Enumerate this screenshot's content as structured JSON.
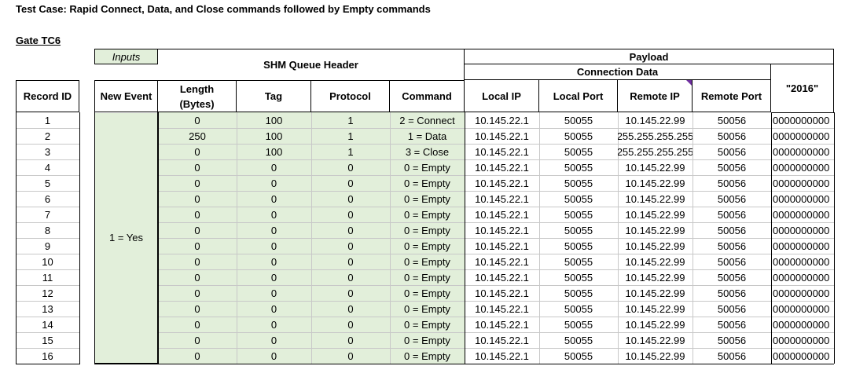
{
  "title": "Test Case: Rapid Connect, Data, and Close commands followed by Empty commands",
  "gate": "Gate TC6",
  "headers": {
    "inputs": "Inputs",
    "shm_queue_header": "SHM Queue Header",
    "payload": "Payload",
    "connection_data": "Connection Data",
    "record_id": "Record ID",
    "new_event": "New Event",
    "length": "Length",
    "length_unit": "(Bytes)",
    "tag": "Tag",
    "protocol": "Protocol",
    "command": "Command",
    "local_ip": "Local IP",
    "local_port": "Local Port",
    "remote_ip": "Remote IP",
    "remote_port": "Remote Port",
    "col_2016": "\"2016\""
  },
  "new_event_value": "1 = Yes",
  "rows": [
    {
      "id": "1",
      "length": "0",
      "tag": "100",
      "protocol": "1",
      "command": "2 = Connect",
      "local_ip": "10.145.22.1",
      "local_port": "50055",
      "remote_ip": "10.145.22.99",
      "remote_port": "50056",
      "v2016": "0000000000"
    },
    {
      "id": "2",
      "length": "250",
      "tag": "100",
      "protocol": "1",
      "command": "1 = Data",
      "local_ip": "10.145.22.1",
      "local_port": "50055",
      "remote_ip": "255.255.255.255",
      "remote_port": "50056",
      "v2016": "0000000000"
    },
    {
      "id": "3",
      "length": "0",
      "tag": "100",
      "protocol": "1",
      "command": "3 = Close",
      "local_ip": "10.145.22.1",
      "local_port": "50055",
      "remote_ip": "255.255.255.255",
      "remote_port": "50056",
      "v2016": "0000000000"
    },
    {
      "id": "4",
      "length": "0",
      "tag": "0",
      "protocol": "0",
      "command": "0 = Empty",
      "local_ip": "10.145.22.1",
      "local_port": "50055",
      "remote_ip": "10.145.22.99",
      "remote_port": "50056",
      "v2016": "0000000000"
    },
    {
      "id": "5",
      "length": "0",
      "tag": "0",
      "protocol": "0",
      "command": "0 = Empty",
      "local_ip": "10.145.22.1",
      "local_port": "50055",
      "remote_ip": "10.145.22.99",
      "remote_port": "50056",
      "v2016": "0000000000"
    },
    {
      "id": "6",
      "length": "0",
      "tag": "0",
      "protocol": "0",
      "command": "0 = Empty",
      "local_ip": "10.145.22.1",
      "local_port": "50055",
      "remote_ip": "10.145.22.99",
      "remote_port": "50056",
      "v2016": "0000000000"
    },
    {
      "id": "7",
      "length": "0",
      "tag": "0",
      "protocol": "0",
      "command": "0 = Empty",
      "local_ip": "10.145.22.1",
      "local_port": "50055",
      "remote_ip": "10.145.22.99",
      "remote_port": "50056",
      "v2016": "0000000000"
    },
    {
      "id": "8",
      "length": "0",
      "tag": "0",
      "protocol": "0",
      "command": "0 = Empty",
      "local_ip": "10.145.22.1",
      "local_port": "50055",
      "remote_ip": "10.145.22.99",
      "remote_port": "50056",
      "v2016": "0000000000"
    },
    {
      "id": "9",
      "length": "0",
      "tag": "0",
      "protocol": "0",
      "command": "0 = Empty",
      "local_ip": "10.145.22.1",
      "local_port": "50055",
      "remote_ip": "10.145.22.99",
      "remote_port": "50056",
      "v2016": "0000000000"
    },
    {
      "id": "10",
      "length": "0",
      "tag": "0",
      "protocol": "0",
      "command": "0 = Empty",
      "local_ip": "10.145.22.1",
      "local_port": "50055",
      "remote_ip": "10.145.22.99",
      "remote_port": "50056",
      "v2016": "0000000000"
    },
    {
      "id": "11",
      "length": "0",
      "tag": "0",
      "protocol": "0",
      "command": "0 = Empty",
      "local_ip": "10.145.22.1",
      "local_port": "50055",
      "remote_ip": "10.145.22.99",
      "remote_port": "50056",
      "v2016": "0000000000"
    },
    {
      "id": "12",
      "length": "0",
      "tag": "0",
      "protocol": "0",
      "command": "0 = Empty",
      "local_ip": "10.145.22.1",
      "local_port": "50055",
      "remote_ip": "10.145.22.99",
      "remote_port": "50056",
      "v2016": "0000000000"
    },
    {
      "id": "13",
      "length": "0",
      "tag": "0",
      "protocol": "0",
      "command": "0 = Empty",
      "local_ip": "10.145.22.1",
      "local_port": "50055",
      "remote_ip": "10.145.22.99",
      "remote_port": "50056",
      "v2016": "0000000000"
    },
    {
      "id": "14",
      "length": "0",
      "tag": "0",
      "protocol": "0",
      "command": "0 = Empty",
      "local_ip": "10.145.22.1",
      "local_port": "50055",
      "remote_ip": "10.145.22.99",
      "remote_port": "50056",
      "v2016": "0000000000"
    },
    {
      "id": "15",
      "length": "0",
      "tag": "0",
      "protocol": "0",
      "command": "0 = Empty",
      "local_ip": "10.145.22.1",
      "local_port": "50055",
      "remote_ip": "10.145.22.99",
      "remote_port": "50056",
      "v2016": "0000000000"
    },
    {
      "id": "16",
      "length": "0",
      "tag": "0",
      "protocol": "0",
      "command": "0 = Empty",
      "local_ip": "10.145.22.1",
      "local_port": "50055",
      "remote_ip": "10.145.22.99",
      "remote_port": "50056",
      "v2016": "0000000000"
    }
  ],
  "colors": {
    "input_fill": "#e2efda",
    "comment_marker": "#7030a0"
  }
}
